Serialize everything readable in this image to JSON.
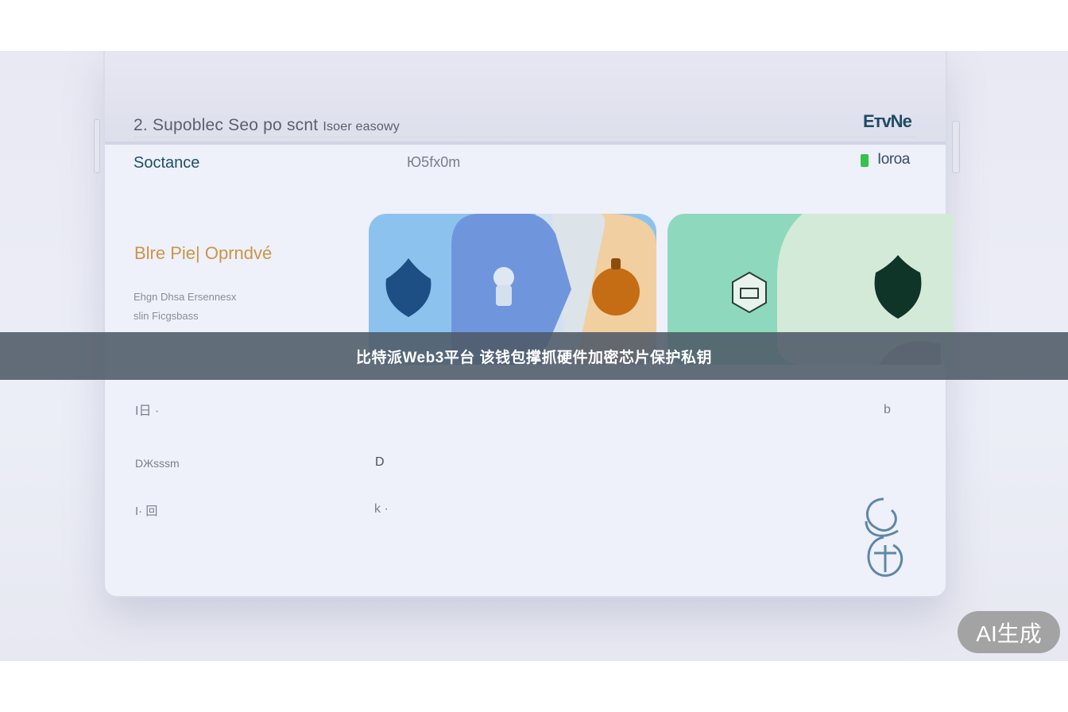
{
  "device": {
    "header_main": "2. Supoblec Seo po scnt",
    "header_small": "Isoer easowy",
    "brand": "ЕтvNe",
    "subheader_left": "Soctance",
    "subheader_mid": "Ю5fx0m",
    "subheader_right": "Ioroa",
    "section_title": "Blre Pie| Oprndvé",
    "section_line1": "Ehgn Dhsa Ersennesx",
    "section_line2": "slin Ficgsbass",
    "row1_left": "I日 ·",
    "row1_right": "b",
    "row2_left": "DЖsssm",
    "row2_mid": "D",
    "row3_left": "I· 回",
    "row3_mid": "k ·"
  },
  "caption": "比特派Web3平台 该钱包撑抓硬件加密芯片保护私钥",
  "badge": "AI生成",
  "colors": {
    "card_blue": "#8cc3ee",
    "card_blue_dark": "#6f96dc",
    "card_peach": "#f1cfa0",
    "card_green": "#8ed9bd",
    "card_green_light": "#d4ead9",
    "brand_teal": "#1f4a66",
    "accent_orange": "#c99648",
    "battery_green": "#36c24c"
  },
  "icons": [
    "water-drop-icon",
    "chef-hat-icon",
    "orange-drop-icon",
    "chip-hex-icon",
    "dark-drop-icon",
    "knot-logo-icon"
  ]
}
